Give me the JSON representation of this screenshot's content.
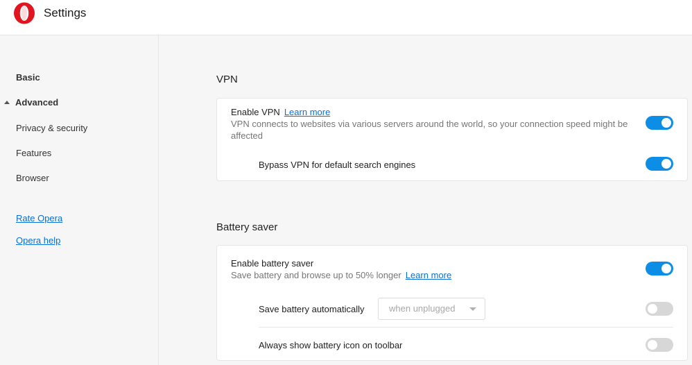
{
  "header": {
    "title": "Settings",
    "logo_icon": "opera-logo-icon",
    "brand_color": "#e0151f"
  },
  "sidebar": {
    "items": [
      {
        "label": "Basic"
      },
      {
        "label": "Advanced",
        "expanded": true
      },
      {
        "label": "Privacy & security"
      },
      {
        "label": "Features"
      },
      {
        "label": "Browser"
      }
    ],
    "links": [
      {
        "label": "Rate Opera"
      },
      {
        "label": "Opera help"
      }
    ]
  },
  "vpn": {
    "section_title": "VPN",
    "enable": {
      "label": "Enable VPN",
      "link": "Learn more",
      "description": "VPN connects to websites via various servers around the world, so your connection speed might be affected",
      "enabled": true
    },
    "bypass": {
      "label": "Bypass VPN for default search engines",
      "enabled": true
    }
  },
  "battery": {
    "section_title": "Battery saver",
    "enable": {
      "label": "Enable battery saver",
      "description": "Save battery and browse up to 50% longer",
      "link": "Learn more",
      "enabled": true
    },
    "auto": {
      "label": "Save battery automatically",
      "select_value": "when unplugged",
      "enabled": false
    },
    "icon": {
      "label": "Always show battery icon on toolbar",
      "enabled": false
    }
  },
  "colors": {
    "accent": "#0c8ee6",
    "link": "#0a6fd6",
    "toggle_off": "#d7d7d7"
  }
}
